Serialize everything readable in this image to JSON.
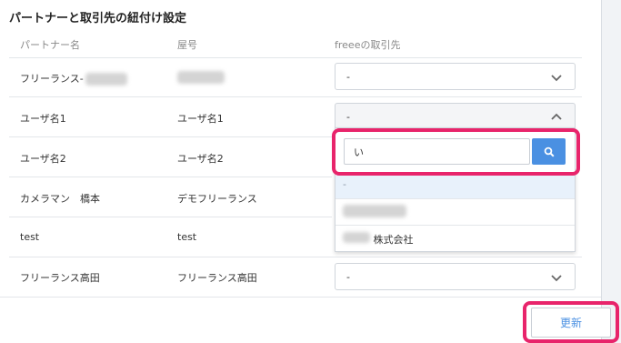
{
  "title": "パートナーと取引先の紐付け設定",
  "columns": {
    "partner": "パートナー名",
    "trade_name": "屋号",
    "freee_client": "freeeの取引先"
  },
  "rows": [
    {
      "partner": "フリーランス-",
      "trade_name": "",
      "client": "-"
    },
    {
      "partner": "ユーザ名1",
      "trade_name": "ユーザ名1",
      "client": "-"
    },
    {
      "partner": "ユーザ名2",
      "trade_name": "ユーザ名2",
      "client": ""
    },
    {
      "partner": "カメラマン　橋本",
      "trade_name": "デモフリーランス",
      "client": ""
    },
    {
      "partner": "test",
      "trade_name": "test",
      "client": ""
    },
    {
      "partner": "フリーランス高田",
      "trade_name": "フリーランス高田",
      "client": "-"
    }
  ],
  "dropdown": {
    "search_value": "い",
    "options": [
      "-",
      "",
      "株式会社"
    ]
  },
  "update_label": "更新",
  "colors": {
    "accent": "#4a90e2",
    "highlight": "#e8246b"
  },
  "icons": {
    "chevron": "chevron-down-icon",
    "search": "search-icon"
  }
}
